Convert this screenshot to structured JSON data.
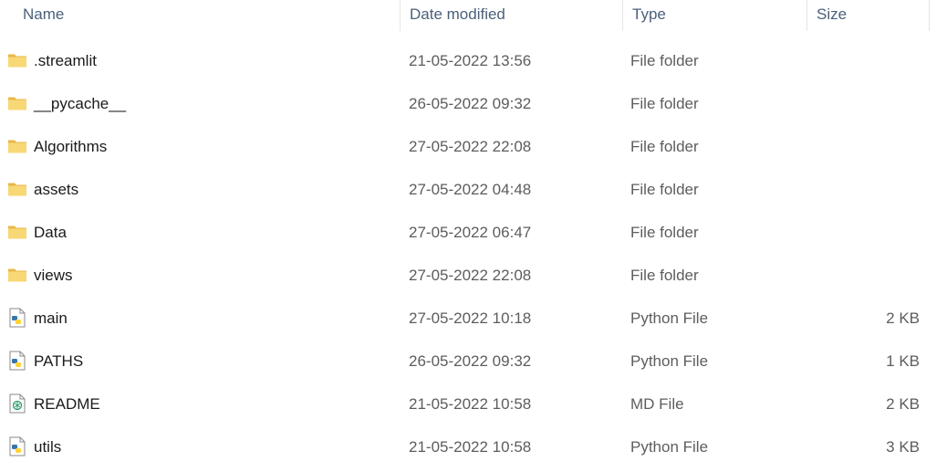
{
  "columns": {
    "name": "Name",
    "date": "Date modified",
    "type": "Type",
    "size": "Size"
  },
  "files": [
    {
      "name": ".streamlit",
      "date": "21-05-2022 13:56",
      "type": "File folder",
      "size": "",
      "icon": "folder-icon"
    },
    {
      "name": "__pycache__",
      "date": "26-05-2022 09:32",
      "type": "File folder",
      "size": "",
      "icon": "folder-icon"
    },
    {
      "name": "Algorithms",
      "date": "27-05-2022 22:08",
      "type": "File folder",
      "size": "",
      "icon": "folder-icon"
    },
    {
      "name": "assets",
      "date": "27-05-2022 04:48",
      "type": "File folder",
      "size": "",
      "icon": "folder-icon"
    },
    {
      "name": "Data",
      "date": "27-05-2022 06:47",
      "type": "File folder",
      "size": "",
      "icon": "folder-icon"
    },
    {
      "name": "views",
      "date": "27-05-2022 22:08",
      "type": "File folder",
      "size": "",
      "icon": "folder-icon"
    },
    {
      "name": "main",
      "date": "27-05-2022 10:18",
      "type": "Python File",
      "size": "2 KB",
      "icon": "python-file-icon"
    },
    {
      "name": "PATHS",
      "date": "26-05-2022 09:32",
      "type": "Python File",
      "size": "1 KB",
      "icon": "python-file-icon"
    },
    {
      "name": "README",
      "date": "21-05-2022 10:58",
      "type": "MD File",
      "size": "2 KB",
      "icon": "markdown-file-icon"
    },
    {
      "name": "utils",
      "date": "21-05-2022 10:58",
      "type": "Python File",
      "size": "3 KB",
      "icon": "python-file-icon"
    }
  ],
  "colors": {
    "folder": "#f8d775",
    "folder_dark": "#e8b84a",
    "header_text": "#4c607a",
    "secondary_text": "#5d5d5d"
  }
}
